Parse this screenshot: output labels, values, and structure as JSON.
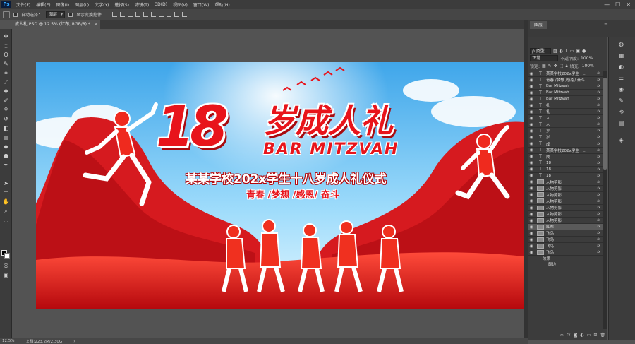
{
  "app": {
    "logo": "Ps",
    "menu": [
      "文件(F)",
      "编辑(E)",
      "图像(I)",
      "图层(L)",
      "文字(Y)",
      "选择(S)",
      "滤镜(T)",
      "3D(D)",
      "视图(V)",
      "窗口(W)",
      "帮助(H)"
    ],
    "window_controls": [
      "—",
      "☐",
      "✕"
    ]
  },
  "options_bar": {
    "auto_select_label": "自动选择：",
    "auto_select_target": "图层",
    "show_transform_label": "显示变换控件"
  },
  "document": {
    "tab_title": "成人礼.PSD @ 12.5% (红布, RGB/8) *",
    "close_icon": "✕"
  },
  "banner": {
    "big_number": "18",
    "title_cn": "岁成人礼",
    "title_en": "BAR MITZVAH",
    "subtitle": "某某学校202x学生十八岁成人礼仪式",
    "tagline": "青春 /梦想 /感恩/ 奋斗",
    "colors": {
      "sky_top": "#5ab8f0",
      "sky_bottom": "#cdeefd",
      "red_primary": "#e8141b",
      "red_dark": "#a80a0f",
      "ribbon": "#d61a1f"
    }
  },
  "layers_panel": {
    "tab_label": "图层",
    "filter_kind": "ρ 类型",
    "blend_mode": "正常",
    "opacity_label": "不透明度:",
    "opacity_value": "100%",
    "lock_label": "锁定:",
    "fill_label": "填充:",
    "fill_value": "100%",
    "layers": [
      {
        "type": "text",
        "name": "某某学校202x学生十..."
      },
      {
        "type": "text",
        "name": "青春 /梦想 /感恩/ 奋斗"
      },
      {
        "type": "text",
        "name": "Bar Mitzvah"
      },
      {
        "type": "text",
        "name": "Bar Mitzvah"
      },
      {
        "type": "text",
        "name": "Bar Mitzvah"
      },
      {
        "type": "text",
        "name": "礼"
      },
      {
        "type": "text",
        "name": "礼"
      },
      {
        "type": "text",
        "name": "人"
      },
      {
        "type": "text",
        "name": "人"
      },
      {
        "type": "text",
        "name": "岁"
      },
      {
        "type": "text",
        "name": "岁"
      },
      {
        "type": "text",
        "name": "成"
      },
      {
        "type": "text",
        "name": "某某学校202x学生十..."
      },
      {
        "type": "text",
        "name": "成"
      },
      {
        "type": "text",
        "name": "18"
      },
      {
        "type": "text",
        "name": "18"
      },
      {
        "type": "text",
        "name": "18"
      },
      {
        "type": "image",
        "name": "人物剪影"
      },
      {
        "type": "image",
        "name": "人物剪影"
      },
      {
        "type": "image",
        "name": "人物剪影"
      },
      {
        "type": "image",
        "name": "人物剪影"
      },
      {
        "type": "image",
        "name": "人物剪影"
      },
      {
        "type": "image",
        "name": "人物剪影"
      },
      {
        "type": "image",
        "name": "人物剪影"
      },
      {
        "type": "image",
        "name": "红布",
        "selected": true
      },
      {
        "type": "image",
        "name": "飞鸟"
      },
      {
        "type": "image",
        "name": "飞鸟"
      },
      {
        "type": "image",
        "name": "飞鸟"
      },
      {
        "type": "image",
        "name": "飞鸟"
      }
    ],
    "effects_label": "效果",
    "effect_item": "颜边"
  },
  "status": {
    "zoom": "12.5%",
    "doc_info": "文档:223.2M/2.30G"
  }
}
